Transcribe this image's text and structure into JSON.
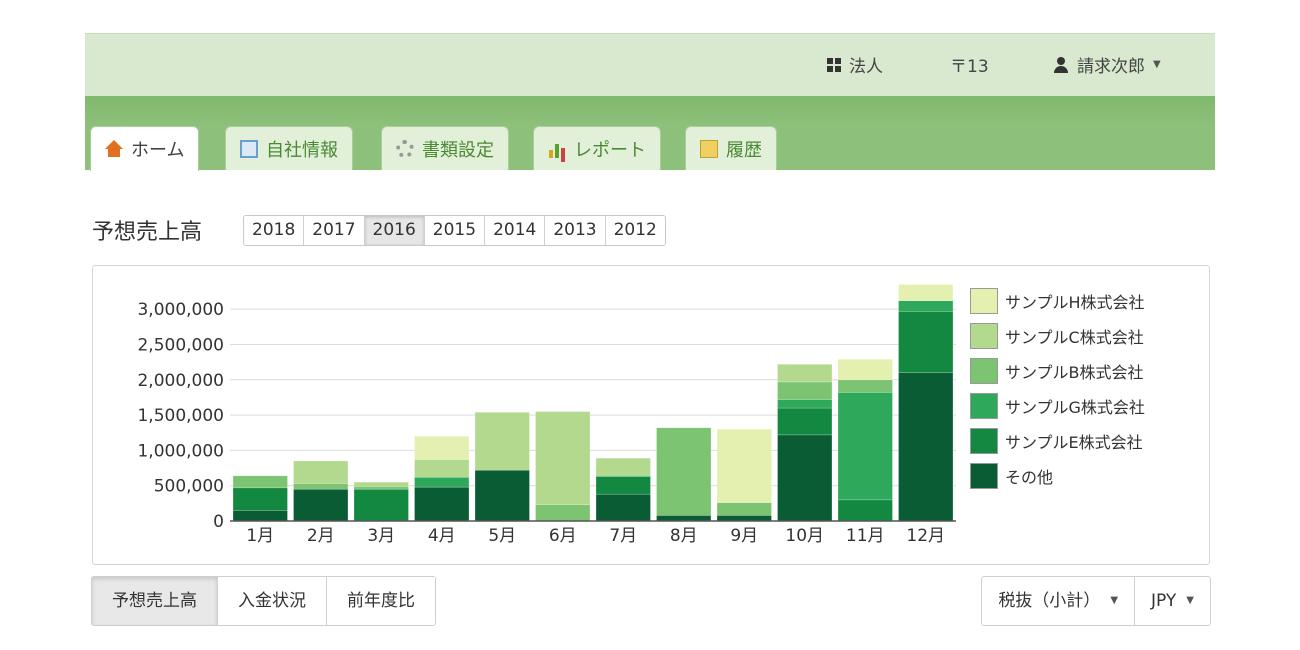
{
  "header": {
    "org_label": "法人",
    "postal_label": "〒13",
    "user_name": "請求次郎"
  },
  "tabs": [
    {
      "label": "ホーム",
      "icon": "home-icon",
      "active": true
    },
    {
      "label": "自社情報",
      "icon": "building-icon",
      "active": false
    },
    {
      "label": "書類設定",
      "icon": "gear-icon",
      "active": false
    },
    {
      "label": "レポート",
      "icon": "chart-icon",
      "active": false
    },
    {
      "label": "履歴",
      "icon": "history-icon",
      "active": false
    }
  ],
  "section_title": "予想売上高",
  "years": [
    "2018",
    "2017",
    "2016",
    "2015",
    "2014",
    "2013",
    "2012"
  ],
  "selected_year": "2016",
  "bottom_tabs": [
    "予想売上高",
    "入金状況",
    "前年度比"
  ],
  "tax_select": "税抜（小計）",
  "currency_select": "JPY",
  "chart_data": {
    "type": "bar",
    "stacked": true,
    "categories": [
      "1月",
      "2月",
      "3月",
      "4月",
      "5月",
      "6月",
      "7月",
      "8月",
      "9月",
      "10月",
      "11月",
      "12月"
    ],
    "ylim": [
      0,
      3300000
    ],
    "yticks": [
      0,
      500000,
      1000000,
      1500000,
      2000000,
      2500000,
      3000000
    ],
    "ytick_labels": [
      "0",
      "500,000",
      "1,000,000",
      "1,500,000",
      "2,000,000",
      "2,500,000",
      "3,000,000"
    ],
    "grid": true,
    "legend_position": "right",
    "series": [
      {
        "name": "その他",
        "color": "#0a5c34",
        "values": [
          150000,
          450000,
          0,
          480000,
          720000,
          0,
          380000,
          80000,
          80000,
          1220000,
          0,
          2100000
        ]
      },
      {
        "name": "サンプルE株式会社",
        "color": "#128840",
        "values": [
          320000,
          0,
          450000,
          0,
          0,
          0,
          250000,
          0,
          0,
          380000,
          300000,
          870000
        ]
      },
      {
        "name": "サンプルG株式会社",
        "color": "#2ea85a",
        "values": [
          0,
          0,
          0,
          140000,
          0,
          0,
          0,
          0,
          0,
          120000,
          1520000,
          150000
        ]
      },
      {
        "name": "サンプルB株式会社",
        "color": "#7cc472",
        "values": [
          170000,
          80000,
          40000,
          0,
          0,
          230000,
          20000,
          1240000,
          180000,
          250000,
          180000,
          0
        ]
      },
      {
        "name": "サンプルC株式会社",
        "color": "#b3d98e",
        "values": [
          0,
          320000,
          60000,
          250000,
          820000,
          1320000,
          240000,
          0,
          0,
          250000,
          0,
          0
        ]
      },
      {
        "name": "サンプルH株式会社",
        "color": "#e3f0b0",
        "values": [
          0,
          0,
          0,
          330000,
          0,
          0,
          0,
          0,
          1040000,
          0,
          290000,
          230000
        ]
      }
    ]
  }
}
